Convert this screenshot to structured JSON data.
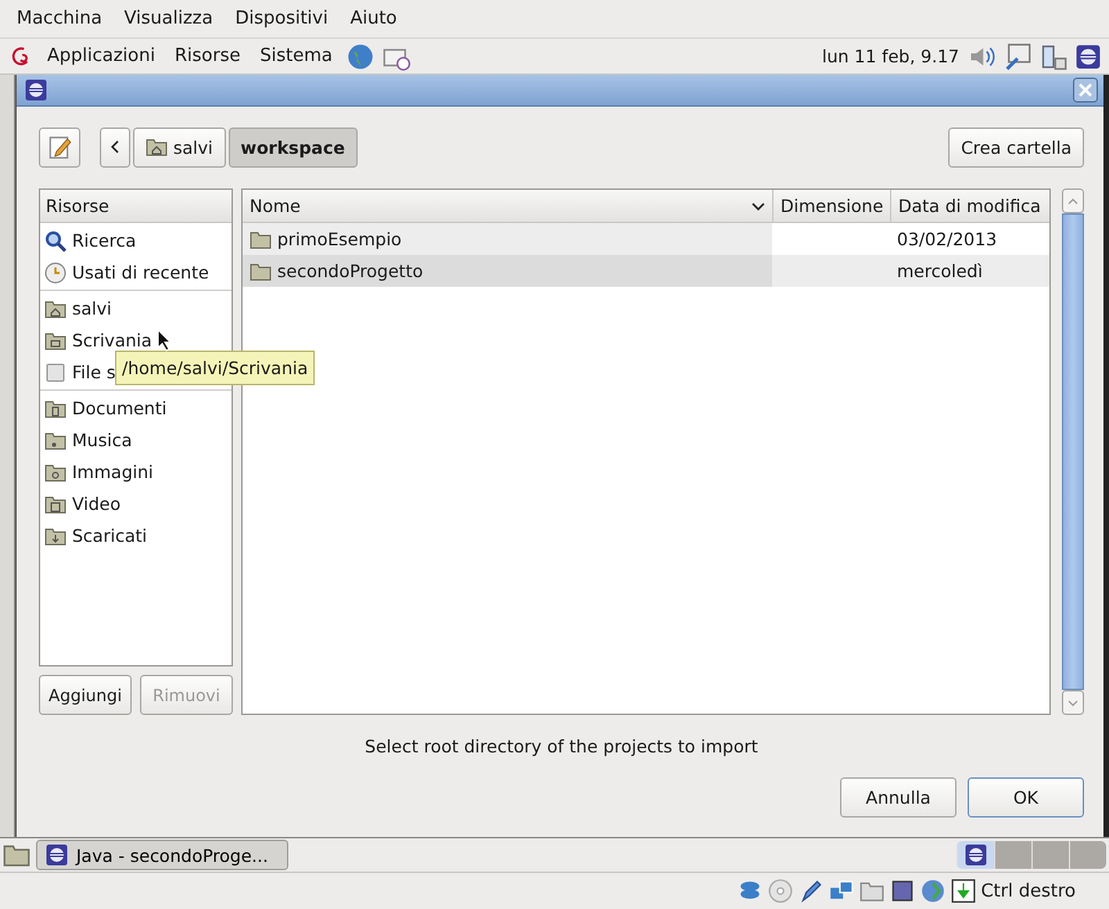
{
  "host_menu": [
    "Macchina",
    "Visualizza",
    "Dispositivi",
    "Aiuto"
  ],
  "panel": {
    "menus": [
      "Applicazioni",
      "Risorse",
      "Sistema"
    ],
    "clock": "lun 11 feb, 9.17"
  },
  "dialog": {
    "path_bar": [
      {
        "label": "salvi",
        "kind": "home",
        "selected": false
      },
      {
        "label": "workspace",
        "kind": "folder",
        "selected": true
      }
    ],
    "create_folder": "Crea cartella",
    "sidebar": {
      "header": "Risorse",
      "groups": [
        [
          {
            "label": "Ricerca",
            "kind": "search"
          },
          {
            "label": "Usati di recente",
            "kind": "recent"
          }
        ],
        [
          {
            "label": "salvi",
            "kind": "home"
          },
          {
            "label": "Scrivania",
            "kind": "desktop"
          },
          {
            "label": "File s",
            "kind": "drive"
          }
        ],
        [
          {
            "label": "Documenti",
            "kind": "documents"
          },
          {
            "label": "Musica",
            "kind": "music"
          },
          {
            "label": "Immagini",
            "kind": "pictures"
          },
          {
            "label": "Video",
            "kind": "video"
          },
          {
            "label": "Scaricati",
            "kind": "downloads"
          }
        ]
      ],
      "buttons": [
        {
          "label": "Aggiungi",
          "disabled": false
        },
        {
          "label": "Rimuovi",
          "disabled": true
        }
      ]
    },
    "tooltip": "/home/salvi/Scrivania",
    "table": {
      "columns": [
        "Nome",
        "Dimensione",
        "Data di modifica"
      ],
      "rows": [
        {
          "name": "primoEsempio",
          "modified": "03/02/2013"
        },
        {
          "name": "secondoProgetto",
          "modified": "mercoledì"
        }
      ]
    },
    "message": "Select root directory of the projects to import",
    "buttons": [
      "Annulla",
      "OK"
    ]
  },
  "taskbar": {
    "tasks": [
      "Java - secondoProge..."
    ]
  },
  "status_bar": {
    "host_key": "Ctrl destro"
  }
}
